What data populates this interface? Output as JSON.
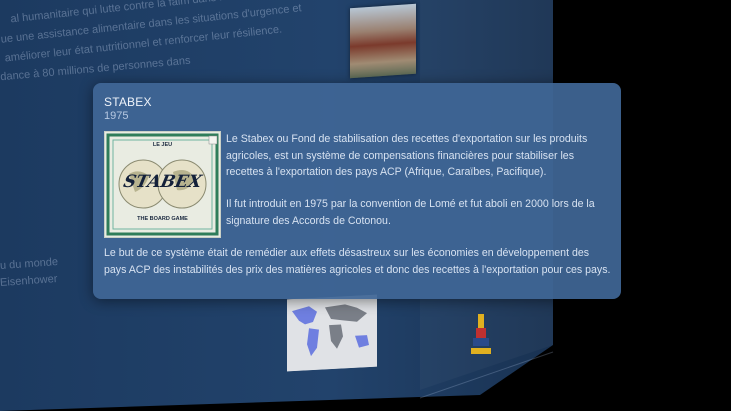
{
  "background": {
    "lines": [
      "al humanitaire qui lutte contre la faim dans le",
      "ue une assistance alimentaire dans les situations d'urgence et",
      "améliorer leur état nutritionnel et renforcer leur résilience.",
      "dance à 80 millions de personnes dans",
      "u du monde",
      "Eisenhower"
    ]
  },
  "popup": {
    "title": "STABEX",
    "year": "1975",
    "image": {
      "top_label": "LE JEU",
      "logo_text": "STABEX",
      "bottom_label": "THE BOARD GAME"
    },
    "paragraphs": [
      "Le Stabex ou Fond de stabilisation des recettes d'exportation sur les produits agricoles, est un système de compensations financières pour stabiliser les recettes à l'exportation des pays ACP (Afrique, Caraïbes, Pacifique).",
      "Il fut introduit en 1975 par la convention de Lomé et fut aboli en 2000 lors de la signature des Accords de Cotonou.",
      "Le but de ce système était de remédier aux effets désastreux sur les économies en développement des pays ACP des instabilités des prix des matières agricoles et donc des recettes à l'exportation pour ces pays."
    ]
  },
  "colors": {
    "popup_bg": "#40669a",
    "wall": "#1f3f66"
  }
}
